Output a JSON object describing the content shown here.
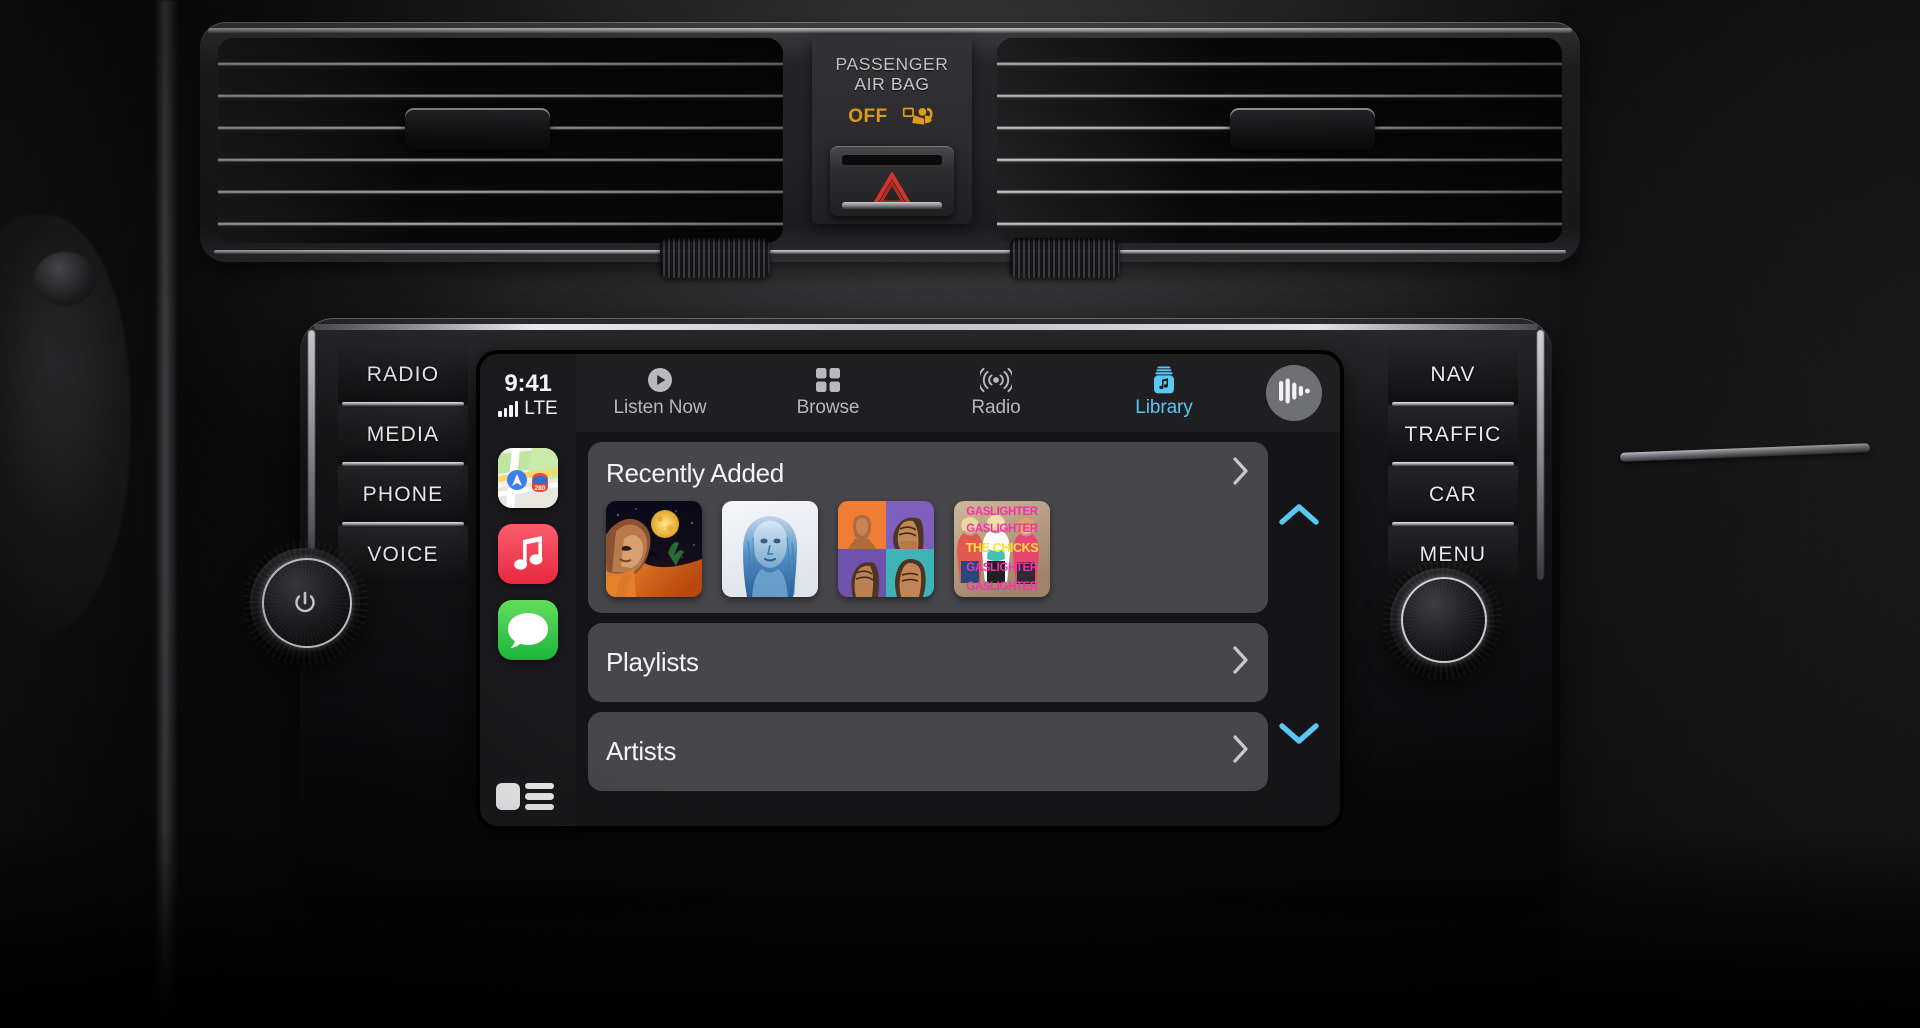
{
  "scene": {
    "description": "Vehicle dashboard head unit running Apple CarPlay Music Library"
  },
  "airbag": {
    "line1": "PASSENGER",
    "line2": "AIR BAG",
    "status": "OFF",
    "symbol_icon": "airbag-child-seat-icon",
    "hazard_icon": "hazard-triangle-icon"
  },
  "head_unit": {
    "left_buttons": [
      {
        "label": "RADIO",
        "name": "radio-button"
      },
      {
        "label": "MEDIA",
        "name": "media-button"
      },
      {
        "label": "PHONE",
        "name": "phone-button"
      },
      {
        "label": "VOICE",
        "name": "voice-button"
      }
    ],
    "right_buttons": [
      {
        "label": "NAV",
        "name": "nav-button"
      },
      {
        "label": "TRAFFIC",
        "name": "traffic-button"
      },
      {
        "label": "CAR",
        "name": "car-button"
      },
      {
        "label": "MENU",
        "name": "menu-button"
      }
    ],
    "left_knob_icon": "power-icon",
    "right_knob_icon": "tune-knob-icon"
  },
  "carplay": {
    "status": {
      "time": "9:41",
      "carrier": "LTE",
      "signal_icon": "signal-bars-icon",
      "signal_bars": 4
    },
    "tabs": [
      {
        "label": "Listen Now",
        "icon": "play-circle-icon",
        "active": false
      },
      {
        "label": "Browse",
        "icon": "grid-squares-icon",
        "active": false
      },
      {
        "label": "Radio",
        "icon": "radio-waves-icon",
        "active": false
      },
      {
        "label": "Library",
        "icon": "library-jar-icon",
        "active": true
      }
    ],
    "siri_button_icon": "siri-waveform-icon",
    "sidebar": {
      "apps": [
        {
          "name": "maps-app-icon",
          "label": "Maps"
        },
        {
          "name": "music-app-icon",
          "label": "Music"
        },
        {
          "name": "messages-app-icon",
          "label": "Messages"
        }
      ],
      "home_icon": "carplay-home-icon"
    },
    "sections": [
      {
        "title": "Recently Added",
        "chevron_icon": "chevron-right-icon",
        "albums": [
          {
            "name": "album-art-night-moon",
            "alt": "Woman in profile under a golden moon, desert night"
          },
          {
            "name": "album-art-blue-portrait",
            "alt": "Blue painted portrait of a woman on white"
          },
          {
            "name": "album-art-four-panel",
            "alt": "Four-panel portrait grid, orange purple teal"
          },
          {
            "name": "album-art-gaslighter",
            "alt": "GASLIGHTER — THE CHICKS, pink and yellow type"
          }
        ]
      },
      {
        "title": "Playlists",
        "chevron_icon": "chevron-right-icon",
        "albums": []
      },
      {
        "title": "Artists",
        "chevron_icon": "chevron-right-icon",
        "albums": []
      }
    ],
    "scroll": {
      "up_icon": "chevron-up-icon",
      "down_icon": "chevron-down-icon"
    },
    "colors": {
      "accent": "#5ac8f5",
      "card": "#47474b",
      "chrome": "#1f1f21",
      "sidebar": "#1a1a1c"
    }
  }
}
